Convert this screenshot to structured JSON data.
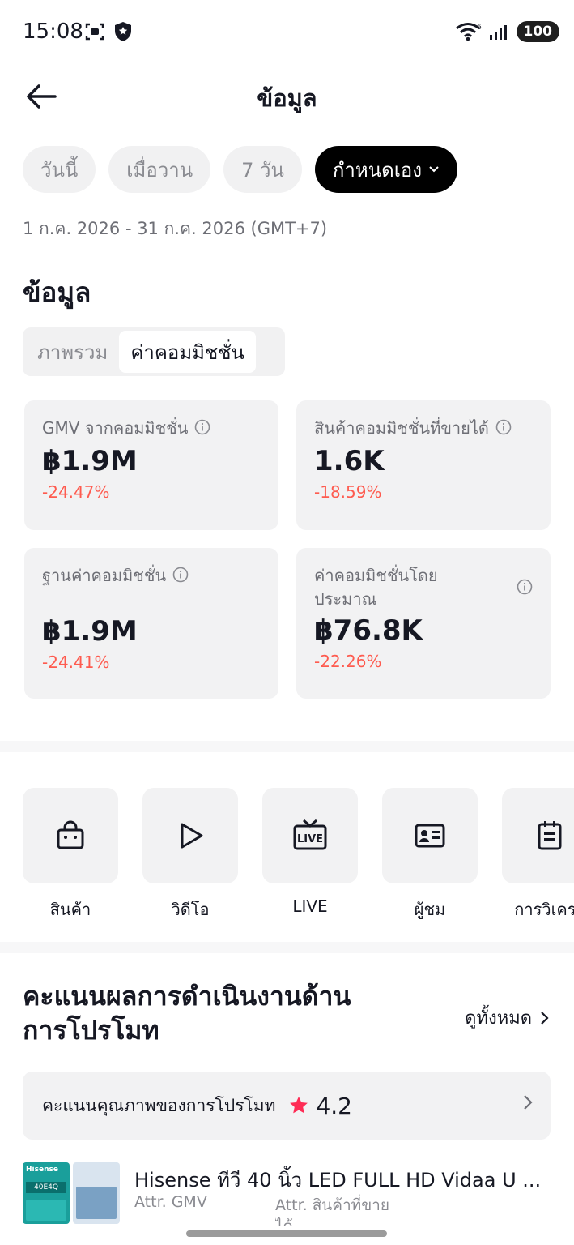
{
  "status": {
    "time": "15:08",
    "battery": "100"
  },
  "nav": {
    "title": "ข้อมูล"
  },
  "chips": [
    {
      "label": "วันนี้"
    },
    {
      "label": "เมื่อวาน"
    },
    {
      "label": "7 วัน"
    },
    {
      "label": "กำหนดเอง"
    }
  ],
  "date_range": "1 ก.ค. 2026 - 31 ก.ค. 2026 (GMT+7)",
  "section_title": "ข้อมูล",
  "segments": [
    {
      "label": "ภาพรวม"
    },
    {
      "label": "ค่าคอมมิชชั่น"
    }
  ],
  "cards": [
    {
      "label": "GMV จากคอมมิชชั่น",
      "value": "฿1.9M",
      "delta": "-24.47%"
    },
    {
      "label": "สินค้าคอมมิชชั่นที่ขายได้",
      "value": "1.6K",
      "delta": "-18.59%"
    },
    {
      "label": "ฐานค่าคอมมิชชั่น",
      "value": "฿1.9M",
      "delta": "-24.41%"
    },
    {
      "label": "ค่าคอมมิชชั่นโดยประมาณ",
      "value": "฿76.8K",
      "delta": "-22.26%"
    }
  ],
  "shortcuts": [
    {
      "label": "สินค้า",
      "icon": "shopping-bag-icon"
    },
    {
      "label": "วิดีโอ",
      "icon": "play-icon"
    },
    {
      "label": "LIVE",
      "icon": "live-tv-icon"
    },
    {
      "label": "ผู้ชม",
      "icon": "id-card-icon"
    },
    {
      "label": "การวิเครา",
      "icon": "clipboard-icon"
    }
  ],
  "performance": {
    "title": "คะแนนผลการดำเนินงานด้านการโปรโมท",
    "see_all": "ดูทั้งหมด",
    "score_label": "คะแนนคุณภาพของการโปรโมท",
    "score_value": "4.2"
  },
  "product": {
    "name": "Hisense ทีวี 40 นิ้ว LED FULL HD Vidaa U ...",
    "attr_gmv": "Attr. GMV",
    "attr_sold": "Attr. สินค้าที่ขาย",
    "attr_sold_cut": "ได้",
    "thumb_brand": "Hisense",
    "thumb_model": "40E4Q"
  },
  "colors": {
    "accent_red": "#fe5b4f",
    "star": "#fe2c55",
    "card_bg": "#f2f2f3"
  }
}
